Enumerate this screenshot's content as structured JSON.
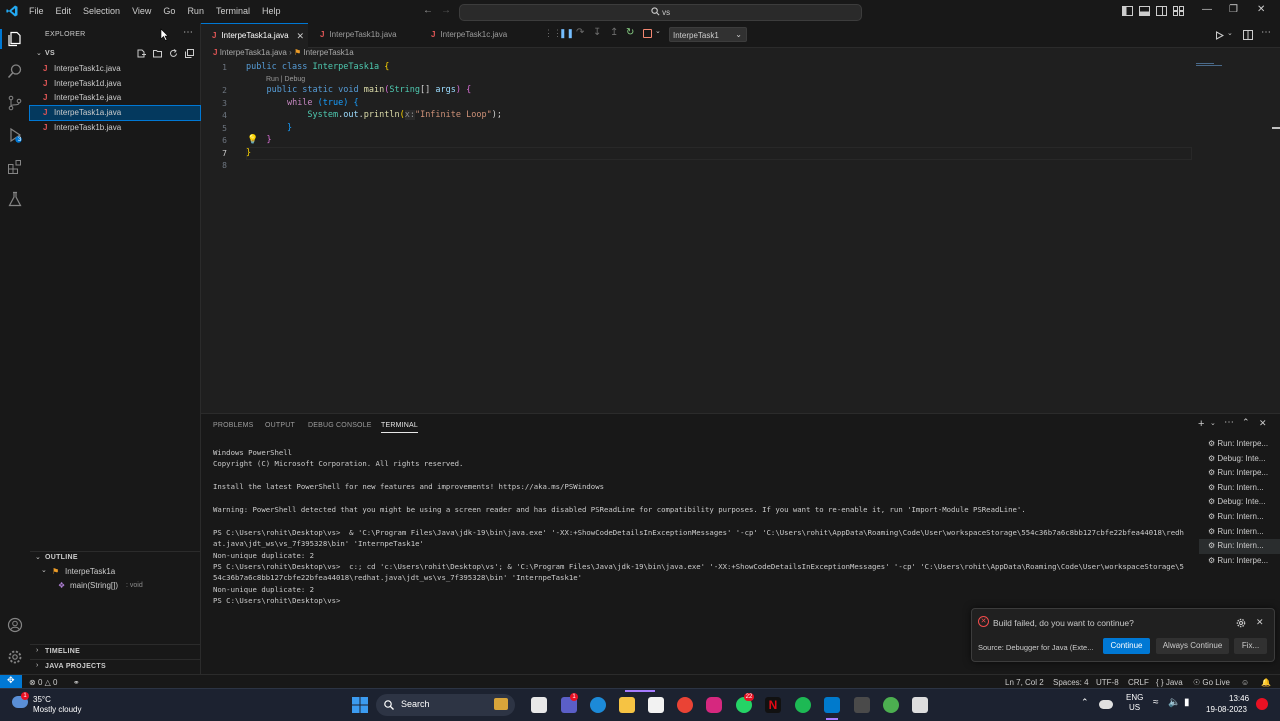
{
  "window": {
    "menu": [
      "File",
      "Edit",
      "Selection",
      "View",
      "Go",
      "Run",
      "Terminal",
      "Help"
    ],
    "search_text": "vs"
  },
  "sidebar": {
    "explorer_title": "EXPLORER",
    "folder": "VS",
    "files": [
      "InterpeTask1c.java",
      "InterpeTask1d.java",
      "InterpeTask1e.java",
      "InterpeTask1a.java",
      "InterpeTask1b.java"
    ],
    "selected_index": 3,
    "outline_title": "OUTLINE",
    "outline_class": "InterpeTask1a",
    "outline_method": "main(String[])",
    "outline_method_type": ": void",
    "timeline_title": "TIMELINE",
    "java_projects_title": "JAVA PROJECTS"
  },
  "tabs": [
    {
      "label": "InterpeTask1a.java",
      "active": true
    },
    {
      "label": "InterpeTask1b.java",
      "active": false
    },
    {
      "label": "InterpeTask1c.java",
      "active": false
    }
  ],
  "debug": {
    "launch_config": "InterpeTask1"
  },
  "breadcrumb": {
    "file": "InterpeTask1a.java",
    "symbol": "InterpeTask1a"
  },
  "editor": {
    "codelens": "Run | Debug",
    "line_numbers": [
      "1",
      "2",
      "3",
      "4",
      "5",
      "6",
      "7",
      "8"
    ],
    "code": {
      "l1_kw": "public class ",
      "l1_name": "InterpeTask1a",
      "l2_kw1": "public static void ",
      "l2_fn": "main",
      "l2_type": "String",
      "l2_arr": "[] ",
      "l2_arg": "args",
      "l3_kw": "while ",
      "l3_cond": "(true) {",
      "l4_sys": "System",
      "l4_out": "out",
      "l4_fn": "println",
      "l4_hint": "x:",
      "l4_str": "\"Infinite Loop\"",
      "l4_end": ");"
    }
  },
  "panel": {
    "tabs": [
      "PROBLEMS",
      "OUTPUT",
      "DEBUG CONSOLE",
      "TERMINAL"
    ],
    "active_tab": "TERMINAL",
    "terminal_lines": [
      "Windows PowerShell",
      "Copyright (C) Microsoft Corporation. All rights reserved.",
      "",
      "Install the latest PowerShell for new features and improvements! https://aka.ms/PSWindows",
      "",
      "Warning: PowerShell detected that you might be using a screen reader and has disabled PSReadLine for compatibility purposes. If you want to re-enable it, run 'Import-Module PSReadLine'.",
      "",
      "PS C:\\Users\\rohit\\Desktop\\vs>  & 'C:\\Program Files\\Java\\jdk-19\\bin\\java.exe' '-XX:+ShowCodeDetailsInExceptionMessages' '-cp' 'C:\\Users\\rohit\\AppData\\Roaming\\Code\\User\\workspaceStorage\\554c36b7a6c8bb127cbfe22bfea44018\\redhat.java\\jdt_ws\\vs_7f395328\\bin' 'InternpeTask1e'",
      "Non-unique duplicate: 2",
      "PS C:\\Users\\rohit\\Desktop\\vs>  c:; cd 'c:\\Users\\rohit\\Desktop\\vs'; & 'C:\\Program Files\\Java\\jdk-19\\bin\\java.exe' '-XX:+ShowCodeDetailsInExceptionMessages' '-cp' 'C:\\Users\\rohit\\AppData\\Roaming\\Code\\User\\workspaceStorage\\554c36b7a6c8bb127cbfe22bfea44018\\redhat.java\\jdt_ws\\vs_7f395328\\bin' 'InternpeTask1e'",
      "Non-unique duplicate: 2",
      "PS C:\\Users\\rohit\\Desktop\\vs>"
    ],
    "terminal_list": [
      "Run: Interpe...",
      "Debug: Inte...",
      "Run: Interpe...",
      "Run: Intern...",
      "Debug: Inte...",
      "Run: Intern...",
      "Run: Intern...",
      "Run: Intern...",
      "Run: Interpe..."
    ],
    "terminal_selected": 7
  },
  "notification": {
    "message": "Build failed, do you want to continue?",
    "source": "Source: Debugger for Java (Exte...",
    "continue": "Continue",
    "always_continue": "Always Continue",
    "fix": "Fix..."
  },
  "statusbar": {
    "errors": "0",
    "warnings": "0",
    "position": "Ln 7, Col 2",
    "spaces": "Spaces: 4",
    "encoding": "UTF-8",
    "eol": "CRLF",
    "language": "Java",
    "golive": "Go Live"
  },
  "taskbar": {
    "weather_temp": "35°C",
    "weather_desc": "Mostly cloudy",
    "search": "Search",
    "lang1": "ENG",
    "lang2": "US",
    "time": "13:46",
    "date": "19-08-2023",
    "badges": {
      "weather": "1",
      "teams": "1",
      "edge_mail": "",
      "whatsapp": "22"
    }
  },
  "colors": {
    "accent": "#0078d4",
    "java_icon": "#e05555",
    "error_icon": "#f14c4c"
  }
}
